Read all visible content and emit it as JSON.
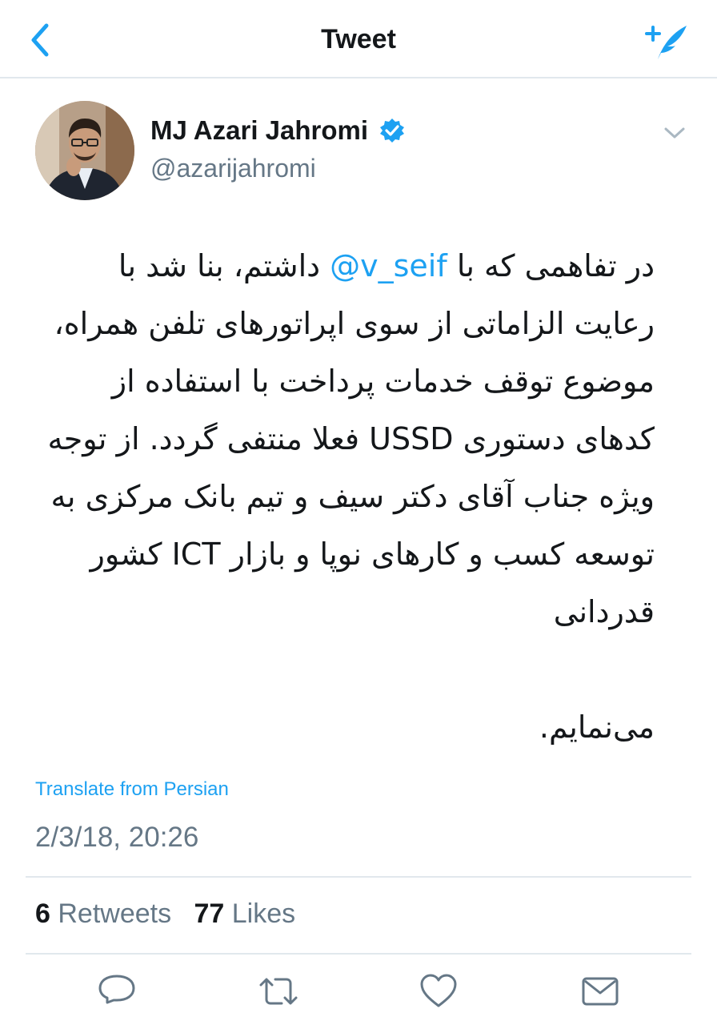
{
  "nav": {
    "title": "Tweet"
  },
  "author": {
    "name": "MJ Azari Jahromi",
    "handle": "@azarijahromi",
    "verified": true
  },
  "tweet": {
    "text_before": "در تفاهمی که با ",
    "mention": "@v_seif",
    "text_after": " داشتم، بنا شد با رعایت الزاماتی از سوی اپراتورهای تلفن همراه، موضوع توقف خدمات پرداخت با استفاده از کدهای دستوری USSD فعلا منتفی گردد. از توجه ویژه جناب آقای دکتر سیف و تیم بانک مرکزی به توسعه کسب و کارهای نوپا و بازار ICT کشور قدردانی\n\nمی‌نمایم."
  },
  "translate_label": "Translate from Persian",
  "timestamp": "2/3/18, 20:26",
  "stats": {
    "retweets_count": "6",
    "retweets_label": "Retweets",
    "likes_count": "77",
    "likes_label": "Likes"
  },
  "icons": {
    "back": "chevron-left-icon",
    "compose": "compose-tweet-icon",
    "verified": "verified-badge-icon",
    "caret": "chevron-down-icon",
    "reply": "reply-icon",
    "retweet": "retweet-icon",
    "like": "heart-icon",
    "share": "mail-icon"
  },
  "colors": {
    "accent": "#1da1f2",
    "text": "#14171a",
    "secondary": "#657786",
    "divider": "#e1e8ed"
  }
}
